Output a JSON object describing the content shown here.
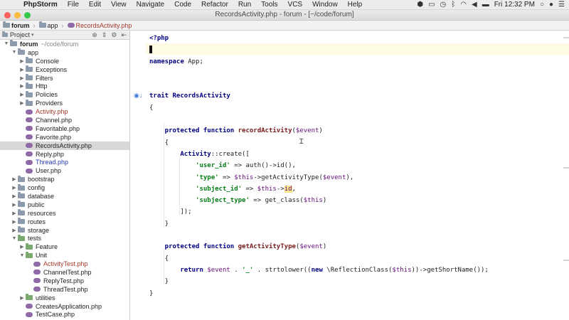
{
  "menubar": {
    "app_name": "PhpStorm",
    "items": [
      "File",
      "Edit",
      "View",
      "Navigate",
      "Code",
      "Refactor",
      "Run",
      "Tools",
      "VCS",
      "Window",
      "Help"
    ],
    "clock": "Fri 12:32 PM"
  },
  "window": {
    "title": "RecordsActivity.php - forum - [~/code/forum]"
  },
  "breadcrumb": {
    "items": [
      {
        "label": "forum",
        "icon": "folder-icon"
      },
      {
        "label": "app",
        "icon": "folder-icon"
      },
      {
        "label": "RecordsActivity.php",
        "icon": "php-file-icon"
      }
    ]
  },
  "project_panel": {
    "title": "Project",
    "tree": [
      {
        "label": "forum",
        "hint": "~/code/forum",
        "type": "root",
        "expanded": true
      },
      {
        "label": "app",
        "type": "folder",
        "expanded": true
      },
      {
        "label": "Console",
        "type": "folder"
      },
      {
        "label": "Exceptions",
        "type": "folder"
      },
      {
        "label": "Filters",
        "type": "folder"
      },
      {
        "label": "Http",
        "type": "folder"
      },
      {
        "label": "Policies",
        "type": "folder"
      },
      {
        "label": "Providers",
        "type": "folder"
      },
      {
        "label": "Activity.php",
        "type": "file",
        "color": "red"
      },
      {
        "label": "Channel.php",
        "type": "file"
      },
      {
        "label": "Favoritable.php",
        "type": "file"
      },
      {
        "label": "Favorite.php",
        "type": "file"
      },
      {
        "label": "RecordsActivity.php",
        "type": "file",
        "selected": true
      },
      {
        "label": "Reply.php",
        "type": "file"
      },
      {
        "label": "Thread.php",
        "type": "file",
        "color": "blue"
      },
      {
        "label": "User.php",
        "type": "file"
      },
      {
        "label": "bootstrap",
        "type": "folder"
      },
      {
        "label": "config",
        "type": "folder"
      },
      {
        "label": "database",
        "type": "folder"
      },
      {
        "label": "public",
        "type": "folder"
      },
      {
        "label": "resources",
        "type": "folder"
      },
      {
        "label": "routes",
        "type": "folder"
      },
      {
        "label": "storage",
        "type": "folder"
      },
      {
        "label": "tests",
        "type": "folder",
        "expanded": true
      },
      {
        "label": "Feature",
        "type": "folder"
      },
      {
        "label": "Unit",
        "type": "folder",
        "expanded": true
      },
      {
        "label": "ActivityTest.php",
        "type": "file",
        "color": "red"
      },
      {
        "label": "ChannelTest.php",
        "type": "file"
      },
      {
        "label": "ReplyTest.php",
        "type": "file"
      },
      {
        "label": "ThreadTest.php",
        "type": "file"
      },
      {
        "label": "utilities",
        "type": "folder"
      },
      {
        "label": "CreatesApplication.php",
        "type": "file"
      },
      {
        "label": "TestCase.php",
        "type": "file"
      }
    ]
  },
  "editor": {
    "lines": [
      [
        {
          "t": "<?php",
          "c": "kw"
        }
      ],
      [],
      [
        {
          "t": "namespace ",
          "c": "kw"
        },
        {
          "t": "App;",
          "c": "plain"
        }
      ],
      [],
      [],
      [
        {
          "t": "trait ",
          "c": "kw"
        },
        {
          "t": "RecordsActivity",
          "c": "cls"
        }
      ],
      [
        {
          "t": "{",
          "c": "plain"
        }
      ],
      [],
      [
        {
          "t": "    protected function ",
          "c": "kw"
        },
        {
          "t": "recordActivity",
          "c": "fn"
        },
        {
          "t": "(",
          "c": "plain"
        },
        {
          "t": "$event",
          "c": "var"
        },
        {
          "t": ")",
          "c": "plain"
        }
      ],
      [
        {
          "t": "    {",
          "c": "plain"
        }
      ],
      [
        {
          "t": "        Activity",
          "c": "cls"
        },
        {
          "t": "::create([",
          "c": "plain"
        }
      ],
      [
        {
          "t": "            ",
          "c": "plain"
        },
        {
          "t": "'user_id'",
          "c": "str"
        },
        {
          "t": " => auth()->id(),",
          "c": "plain"
        }
      ],
      [
        {
          "t": "            ",
          "c": "plain"
        },
        {
          "t": "'type'",
          "c": "str"
        },
        {
          "t": " => ",
          "c": "plain"
        },
        {
          "t": "$this",
          "c": "var"
        },
        {
          "t": "->getActivityType(",
          "c": "plain"
        },
        {
          "t": "$event",
          "c": "var"
        },
        {
          "t": "),",
          "c": "plain"
        }
      ],
      [
        {
          "t": "            ",
          "c": "plain"
        },
        {
          "t": "'subject_id'",
          "c": "str"
        },
        {
          "t": " => ",
          "c": "plain"
        },
        {
          "t": "$this",
          "c": "var"
        },
        {
          "t": "->",
          "c": "plain"
        },
        {
          "t": "id",
          "c": "var hl-id"
        },
        {
          "t": ",",
          "c": "plain"
        }
      ],
      [
        {
          "t": "            ",
          "c": "plain"
        },
        {
          "t": "'subject_type'",
          "c": "str"
        },
        {
          "t": " => get_class(",
          "c": "plain"
        },
        {
          "t": "$this",
          "c": "var"
        },
        {
          "t": ")",
          "c": "plain"
        }
      ],
      [
        {
          "t": "        ]);",
          "c": "plain"
        }
      ],
      [
        {
          "t": "    }",
          "c": "plain"
        }
      ],
      [],
      [
        {
          "t": "    protected function ",
          "c": "kw"
        },
        {
          "t": "getActivityType",
          "c": "fn"
        },
        {
          "t": "(",
          "c": "plain"
        },
        {
          "t": "$event",
          "c": "var"
        },
        {
          "t": ")",
          "c": "plain"
        }
      ],
      [
        {
          "t": "    {",
          "c": "plain"
        }
      ],
      [
        {
          "t": "        return ",
          "c": "kw"
        },
        {
          "t": "$event",
          "c": "var"
        },
        {
          "t": " . ",
          "c": "plain"
        },
        {
          "t": "'_'",
          "c": "str"
        },
        {
          "t": " . strtolower((",
          "c": "plain"
        },
        {
          "t": "new ",
          "c": "kw"
        },
        {
          "t": "\\ReflectionClass(",
          "c": "plain"
        },
        {
          "t": "$this",
          "c": "var"
        },
        {
          "t": "))->getShortName());",
          "c": "plain"
        }
      ],
      [
        {
          "t": "    }",
          "c": "plain"
        }
      ],
      [
        {
          "t": "}",
          "c": "plain"
        }
      ]
    ]
  }
}
